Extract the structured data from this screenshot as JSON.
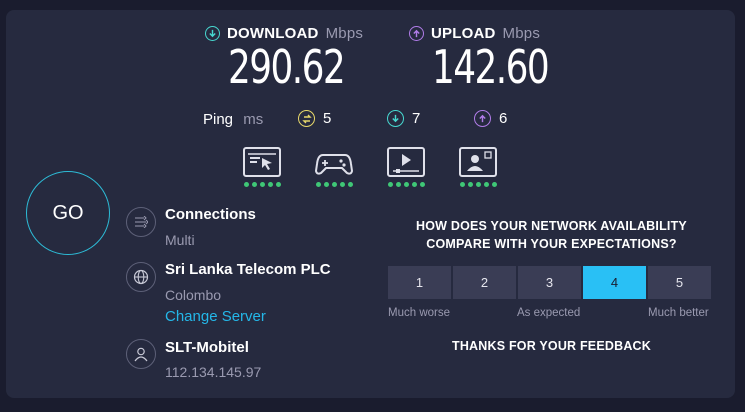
{
  "download": {
    "label": "DOWNLOAD",
    "unit": "Mbps",
    "value": "290.62"
  },
  "upload": {
    "label": "UPLOAD",
    "unit": "Mbps",
    "value": "142.60"
  },
  "ping": {
    "label": "Ping",
    "unit": "ms",
    "idle": "5",
    "down": "7",
    "up": "6"
  },
  "experience_tiles": [
    {
      "icon": "browsing-icon",
      "rating_dots": 5
    },
    {
      "icon": "gaming-icon",
      "rating_dots": 5
    },
    {
      "icon": "video-streaming-icon",
      "rating_dots": 5
    },
    {
      "icon": "video-call-icon",
      "rating_dots": 5
    }
  ],
  "go_label": "GO",
  "connections": {
    "title": "Connections",
    "value": "Multi"
  },
  "server": {
    "name": "Sri Lanka Telecom PLC",
    "city": "Colombo",
    "change_label": "Change Server"
  },
  "isp": {
    "name": "SLT-Mobitel",
    "ip": "112.134.145.97"
  },
  "survey": {
    "question_line1": "HOW DOES YOUR NETWORK AVAILABILITY",
    "question_line2": "COMPARE WITH YOUR EXPECTATIONS?",
    "options": [
      "1",
      "2",
      "3",
      "4",
      "5"
    ],
    "selected": "4",
    "low_label": "Much worse",
    "mid_label": "As expected",
    "high_label": "Much better",
    "thanks": "THANKS FOR YOUR FEEDBACK"
  },
  "colors": {
    "background": "#1a1c2e",
    "panel": "#262a3f",
    "download": "#47d8d0",
    "upload": "#b07ce8",
    "idle_ping": "#e7d86a",
    "accent": "#29c0f5",
    "rating_dot": "#3fc776"
  }
}
